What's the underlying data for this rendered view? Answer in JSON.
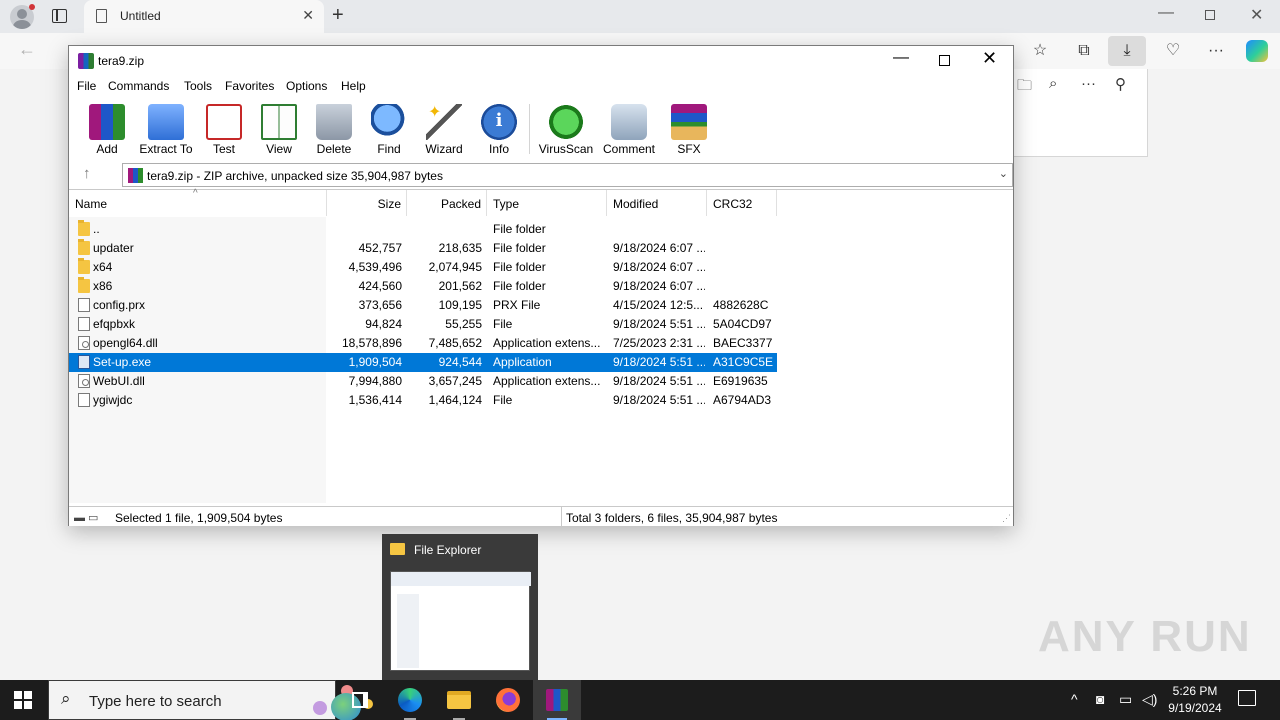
{
  "browser": {
    "tab_title": "Untitled",
    "tab_close": "✕",
    "new_tab": "+",
    "window_minimize": "—",
    "window_close": "✕",
    "back": "←",
    "icons": [
      "favorites-icon",
      "collections-icon",
      "downloads-icon",
      "performance-icon",
      "more-icon",
      "copilot-icon"
    ],
    "more_glyph": "···"
  },
  "winrar": {
    "title": "tera9.zip",
    "menu": [
      "File",
      "Commands",
      "Tools",
      "Favorites",
      "Options",
      "Help"
    ],
    "tools": [
      "Add",
      "Extract To",
      "Test",
      "View",
      "Delete",
      "Find",
      "Wizard",
      "Info",
      "VirusScan",
      "Comment",
      "SFX"
    ],
    "path": "tera9.zip - ZIP archive, unpacked size 35,904,987 bytes",
    "columns": {
      "name": "Name",
      "size": "Size",
      "packed": "Packed",
      "type": "Type",
      "modified": "Modified",
      "crc": "CRC32"
    },
    "rows": [
      {
        "name": "..",
        "size": "",
        "packed": "",
        "type": "File folder",
        "modified": "",
        "crc": "",
        "icon": "folder-icon"
      },
      {
        "name": "updater",
        "size": "452,757",
        "packed": "218,635",
        "type": "File folder",
        "modified": "9/18/2024 6:07 ...",
        "crc": "",
        "icon": "folder-icon"
      },
      {
        "name": "x64",
        "size": "4,539,496",
        "packed": "2,074,945",
        "type": "File folder",
        "modified": "9/18/2024 6:07 ...",
        "crc": "",
        "icon": "folder-icon"
      },
      {
        "name": "x86",
        "size": "424,560",
        "packed": "201,562",
        "type": "File folder",
        "modified": "9/18/2024 6:07 ...",
        "crc": "",
        "icon": "folder-icon"
      },
      {
        "name": "config.prx",
        "size": "373,656",
        "packed": "109,195",
        "type": "PRX File",
        "modified": "4/15/2024 12:5...",
        "crc": "4882628C",
        "icon": "document-icon"
      },
      {
        "name": "efqpbxk",
        "size": "94,824",
        "packed": "55,255",
        "type": "File",
        "modified": "9/18/2024 5:51 ...",
        "crc": "5A04CD97",
        "icon": "document-icon"
      },
      {
        "name": "opengl64.dll",
        "size": "18,578,896",
        "packed": "7,485,652",
        "type": "Application extens...",
        "modified": "7/25/2023 2:31 ...",
        "crc": "BAEC3377",
        "icon": "dll-icon"
      },
      {
        "name": "Set-up.exe",
        "size": "1,909,504",
        "packed": "924,544",
        "type": "Application",
        "modified": "9/18/2024 5:51 ...",
        "crc": "A31C9C5E",
        "icon": "exe-icon",
        "selected": true
      },
      {
        "name": "WebUI.dll",
        "size": "7,994,880",
        "packed": "3,657,245",
        "type": "Application extens...",
        "modified": "9/18/2024 5:51 ...",
        "crc": "E6919635",
        "icon": "dll-icon"
      },
      {
        "name": "ygiwjdc",
        "size": "1,536,414",
        "packed": "1,464,124",
        "type": "File",
        "modified": "9/18/2024 5:51 ...",
        "crc": "A6794AD3",
        "icon": "document-icon"
      }
    ],
    "status_left": "Selected 1 file, 1,909,504 bytes",
    "status_right": "Total 3 folders, 6 files, 35,904,987 bytes"
  },
  "preview": {
    "title": "File Explorer"
  },
  "watermark": "ANY RUN",
  "taskbar": {
    "search_placeholder": "Type here to search",
    "time": "5:26 PM",
    "date": "9/19/2024",
    "selection_color": "#0078d7"
  }
}
